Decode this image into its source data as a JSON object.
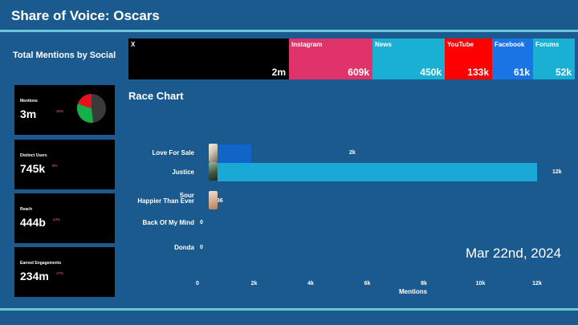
{
  "header": {
    "title": "Share of Voice: Oscars"
  },
  "total_mentions": {
    "label": "Total Mentions by Social",
    "segments": [
      {
        "name": "X",
        "value": "2m",
        "color": "#000000"
      },
      {
        "name": "Instagram",
        "value": "609k",
        "color": "#e0336a"
      },
      {
        "name": "News",
        "value": "450k",
        "color": "#1ab0d4"
      },
      {
        "name": "YouTube",
        "value": "133k",
        "color": "#ff0000"
      },
      {
        "name": "Facebook",
        "value": "61k",
        "color": "#1b74e4"
      },
      {
        "name": "Forums",
        "value": "52k",
        "color": "#1ab0d4"
      }
    ]
  },
  "kpis": [
    {
      "label": "Mentions",
      "value": "3m",
      "change": "10%"
    },
    {
      "label": "Distinct Users",
      "value": "745k",
      "change": "9%"
    },
    {
      "label": "Reach",
      "value": "444b",
      "change": "24%"
    },
    {
      "label": "Earned Engagements",
      "value": "234m",
      "change": "17%"
    }
  ],
  "race": {
    "title": "Race Chart",
    "date": "Mar 22nd, 2024"
  },
  "chart_data": {
    "type": "bar",
    "orientation": "horizontal",
    "title": "Race Chart",
    "categories": [
      "Love For Sale",
      "Justice",
      "Sour",
      "Happier Than Ever",
      "Back Of My Mind",
      "Donda"
    ],
    "values": [
      1900,
      12000,
      436,
      436,
      0,
      0
    ],
    "value_labels": [
      "2k",
      "12k",
      "436",
      "436",
      "0",
      "0"
    ],
    "colors": [
      "#1164c8",
      "#1aa8d6",
      "#1aa8d6",
      "#1aa8d6",
      "#1aa8d6",
      "#1aa8d6"
    ],
    "xlabel": "Mentions",
    "xlim": [
      0,
      12800
    ],
    "xticks": [
      0,
      2000,
      4000,
      6000,
      8000,
      10000,
      12000
    ],
    "xtick_labels": [
      "0",
      "2k",
      "4k",
      "6k",
      "8k",
      "10k",
      "12k"
    ],
    "grid": false
  }
}
